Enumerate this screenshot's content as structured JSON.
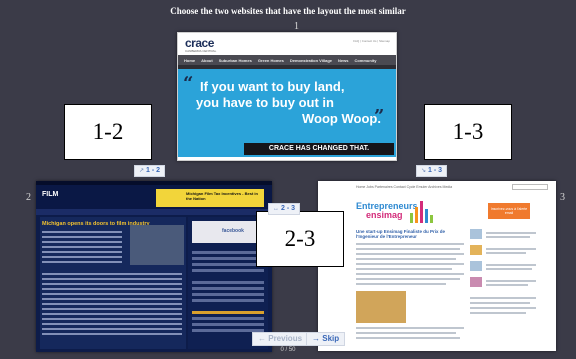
{
  "prompt": "Choose the two websites that have the layout the most similar",
  "panels": {
    "n1": "1",
    "n2": "2",
    "n3": "3"
  },
  "site1": {
    "logo": "crace",
    "logo_sub": "CANBERRA CENTRAL",
    "toplinks": "FAQ | Contact Us | Sitemap",
    "nav": [
      "Home",
      "About",
      "Suburban Homes",
      "Green Homes",
      "Demonstration Village",
      "News",
      "Community"
    ],
    "quote_open": "“",
    "quote_close": "”",
    "line1": "If you want to buy land,",
    "line2": "you have to buy out in",
    "line3": "Woop Woop.",
    "banner": "CRACE HAS CHANGED THAT."
  },
  "site2": {
    "logo": "FILM",
    "ad": "Michigan Film Tax Incentives - Best in the Nation",
    "headline": "Michigan opens its doors to film industry",
    "side_label": "facebook"
  },
  "site3": {
    "nav": "Home   Jobs   Partenaires   Contact   Cycle Emuler   Archives   Media",
    "logo1": "Entrepreneurs",
    "logo2": "ensimag",
    "btn": "Inscrivez-vous à l'alerte email",
    "headline": "Une start-up Ensimag Finaliste du Prix de l'Ingenieur de l'Entrepreneur"
  },
  "choices": {
    "box12": "1-2",
    "box13": "1-3",
    "box23": "2-3",
    "btn12": "1 - 2",
    "btn13": "1 - 3",
    "btn23": "2 - 3"
  },
  "nav": {
    "previous": "Previous",
    "skip": "Skip",
    "counter": "0 / 50"
  },
  "colors": {
    "background": "#3b3b48",
    "button_text": "#3a68b8"
  }
}
